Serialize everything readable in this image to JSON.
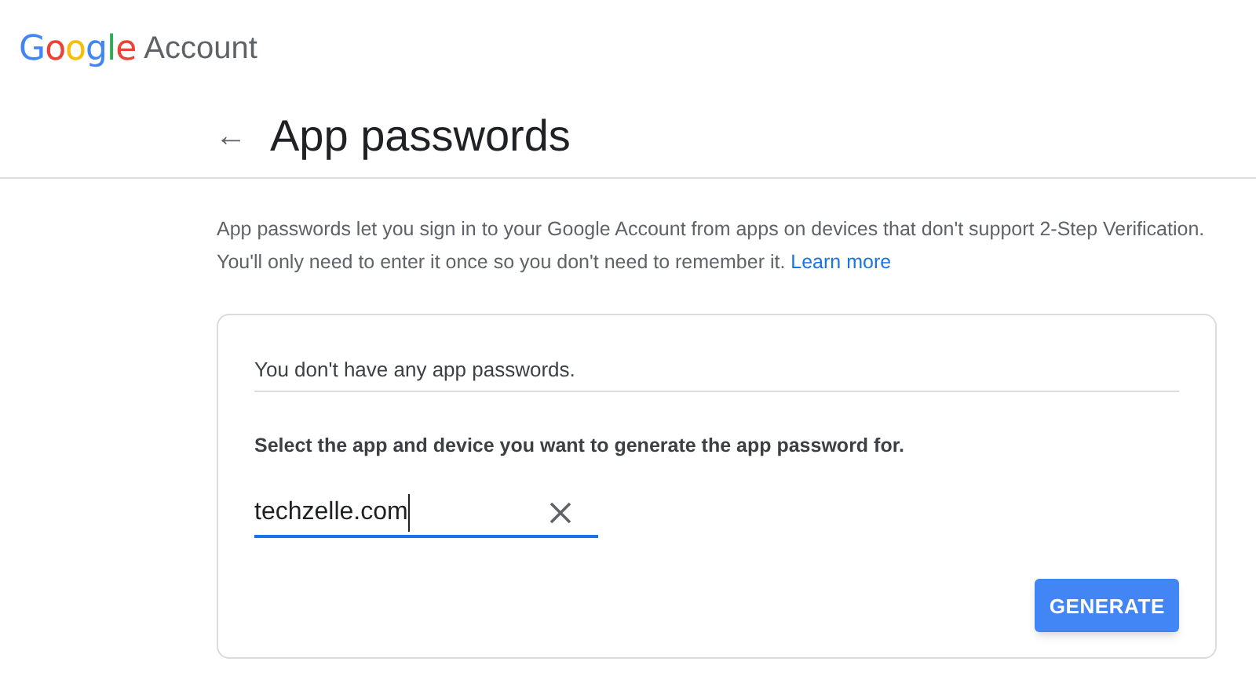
{
  "header": {
    "logo": "Google",
    "product": "Account"
  },
  "page": {
    "back": "←",
    "title": "App passwords"
  },
  "intro": {
    "text": "App passwords let you sign in to your Google Account from apps on devices that don't support 2-Step Verification. You'll only need to enter it once so you don't need to remember it.",
    "link": "Learn more"
  },
  "card": {
    "empty_message": "You don't have any app passwords.",
    "instruction": "Select the app and device you want to generate the app password for.",
    "app_field": {
      "value": "techzelle.com",
      "focused": true
    },
    "button": "GENERATE"
  }
}
